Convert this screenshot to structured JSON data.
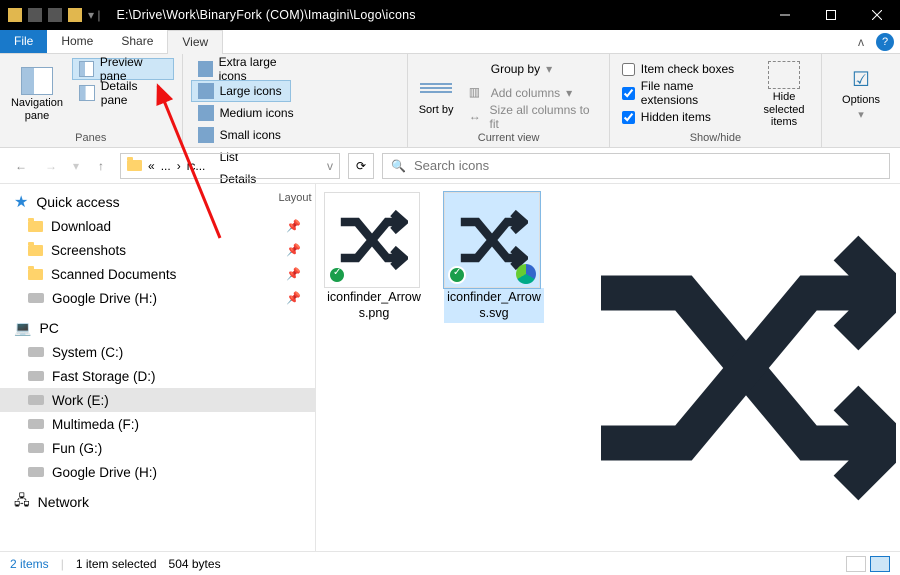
{
  "title_path": "E:\\Drive\\Work\\BinaryFork (COM)\\Imagini\\Logo\\icons",
  "tabs": {
    "file": "File",
    "home": "Home",
    "share": "Share",
    "view": "View"
  },
  "ribbon": {
    "panes": {
      "label": "Panes",
      "navigation": "Navigation pane",
      "preview": "Preview pane",
      "details": "Details pane"
    },
    "layout": {
      "label": "Layout",
      "xl": "Extra large icons",
      "large": "Large icons",
      "medium": "Medium icons",
      "small": "Small icons",
      "list": "List",
      "details": "Details"
    },
    "current": {
      "label": "Current view",
      "sort": "Sort by",
      "group": "Group by",
      "addcols": "Add columns",
      "sizecols": "Size all columns to fit"
    },
    "showhide": {
      "label": "Show/hide",
      "checkboxes": "Item check boxes",
      "ext": "File name extensions",
      "hidden": "Hidden items",
      "hidesel": "Hide selected items"
    },
    "options": "Options"
  },
  "breadcrumb": {
    "ellipsis": "...",
    "current_short": "ic...",
    "current": "icons"
  },
  "search_placeholder": "Search icons",
  "sidebar": {
    "quick": "Quick access",
    "items": [
      "Download",
      "Screenshots",
      "Scanned Documents",
      "Google Drive (H:)"
    ],
    "pc": "PC",
    "drives": [
      "System (C:)",
      "Fast Storage (D:)",
      "Work (E:)",
      "Multimeda (F:)",
      "Fun (G:)",
      "Google Drive (H:)"
    ],
    "network": "Network"
  },
  "files": [
    {
      "name": "iconfinder_Arrows.png",
      "selected": false,
      "svg": false
    },
    {
      "name": "iconfinder_Arrows.svg",
      "selected": true,
      "svg": true
    }
  ],
  "status": {
    "count": "2 items",
    "selection": "1 item selected",
    "size": "504 bytes"
  },
  "checks": {
    "checkboxes": false,
    "ext": true,
    "hidden": true
  }
}
